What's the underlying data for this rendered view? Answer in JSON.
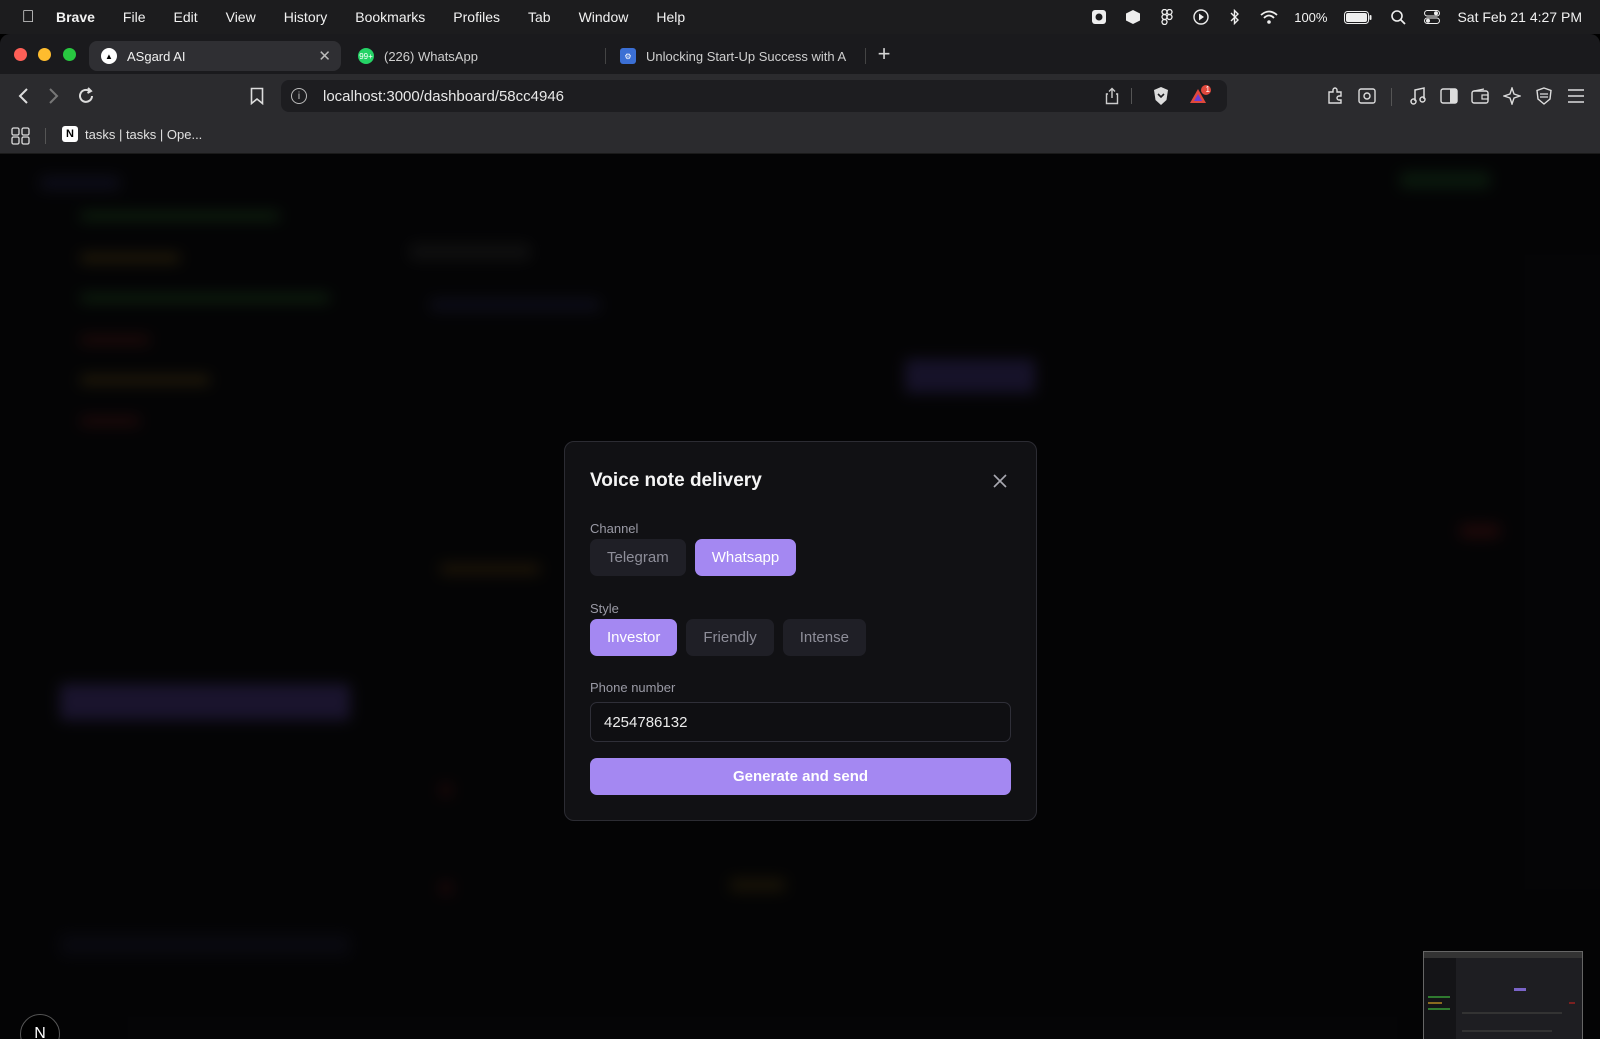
{
  "menubar": {
    "app": "Brave",
    "items": [
      "File",
      "Edit",
      "View",
      "History",
      "Bookmarks",
      "Profiles",
      "Tab",
      "Window",
      "Help"
    ],
    "battery": "100%",
    "datetime": "Sat Feb 21  4:27 PM"
  },
  "tabs": [
    {
      "label": "ASgard AI"
    },
    {
      "label": "(226) WhatsApp",
      "badge": "99+"
    },
    {
      "label": "Unlocking Start-Up Success with A"
    }
  ],
  "address": {
    "url": "localhost:3000/dashboard/58cc4946",
    "shield_count": "1"
  },
  "bookmarks": [
    {
      "label": "tasks | tasks | Ope...",
      "icon": "N"
    }
  ],
  "modal": {
    "title": "Voice note delivery",
    "channel_label": "Channel",
    "channel_options": [
      "Telegram",
      "Whatsapp"
    ],
    "channel_selected": "Whatsapp",
    "style_label": "Style",
    "style_options": [
      "Investor",
      "Friendly",
      "Intense"
    ],
    "style_selected": "Investor",
    "phone_label": "Phone number",
    "phone_value": "4254786132",
    "submit_label": "Generate and send"
  },
  "colors": {
    "accent": "#a488f2",
    "modal_bg": "#111114",
    "chip_bg": "#1f1f26"
  },
  "next_badge": "N"
}
